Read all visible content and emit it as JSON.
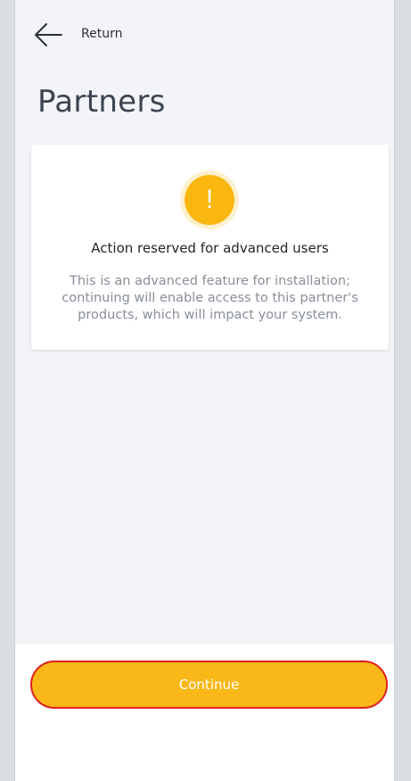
{
  "header": {
    "back_label": "Return",
    "title": "Partners"
  },
  "warning": {
    "icon": "exclamation-icon",
    "symbol": "!",
    "heading": "Action reserved for advanced users",
    "message": "This is an advanced feature for installation; continuing will enable access to this partner's products, which will impact your system."
  },
  "footer": {
    "continue_label": "Continue"
  },
  "colors": {
    "accent": "#f9b817",
    "background": "#f3f4f7",
    "title": "#3b4450",
    "muted_text": "#888e99",
    "highlight_border": "#e02020"
  }
}
